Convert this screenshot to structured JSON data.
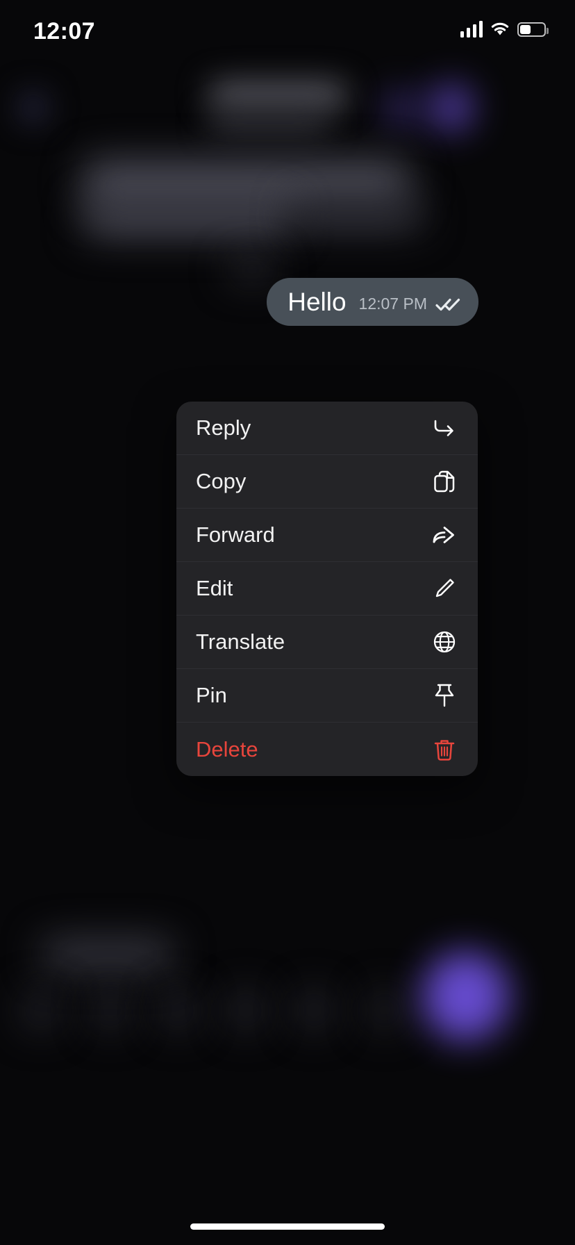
{
  "status_bar": {
    "time": "12:07",
    "signal_icon": "cellular-signal-icon",
    "wifi_icon": "wifi-icon",
    "battery_icon": "battery-icon",
    "battery_level_percent": 45
  },
  "message": {
    "text": "Hello",
    "timestamp": "12:07 PM",
    "status_icon": "double-check-icon",
    "bubble_color": "#485058",
    "outgoing": true
  },
  "context_menu": {
    "background_color": "#242427",
    "items": [
      {
        "label": "Reply",
        "icon": "reply-arrow-icon",
        "destructive": false
      },
      {
        "label": "Copy",
        "icon": "copy-icon",
        "destructive": false
      },
      {
        "label": "Forward",
        "icon": "forward-arrow-icon",
        "destructive": false
      },
      {
        "label": "Edit",
        "icon": "pencil-icon",
        "destructive": false
      },
      {
        "label": "Translate",
        "icon": "globe-icon",
        "destructive": false
      },
      {
        "label": "Pin",
        "icon": "pushpin-icon",
        "destructive": false
      },
      {
        "label": "Delete",
        "icon": "trash-icon",
        "destructive": true
      }
    ],
    "destructive_color": "#e8453c"
  },
  "home_indicator": {
    "name": "home-indicator"
  }
}
